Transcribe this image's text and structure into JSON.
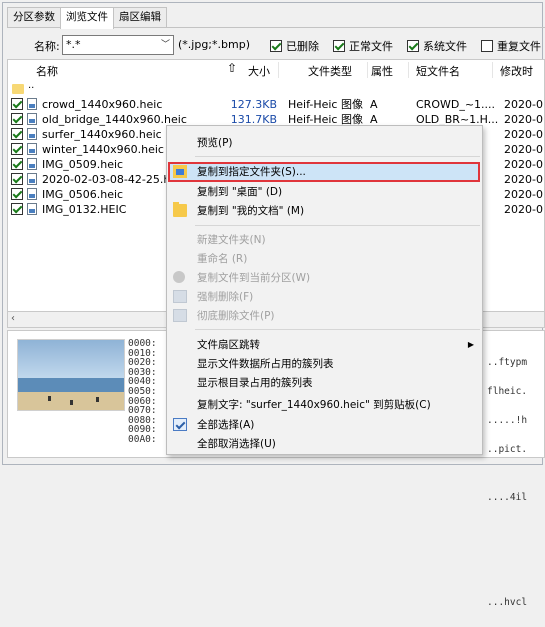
{
  "tabs": [
    "分区参数",
    "浏览文件",
    "扇区编辑"
  ],
  "filter": {
    "name_label": "名称:",
    "name_value": "*.*",
    "extensions": "(*.jpg;*.bmp)",
    "checkboxes": [
      {
        "label": "已删除",
        "checked": true
      },
      {
        "label": "正常文件",
        "checked": true
      },
      {
        "label": "系统文件",
        "checked": true
      },
      {
        "label": "重复文件",
        "checked": false
      }
    ]
  },
  "columns": {
    "name": "名称",
    "size": "大小",
    "type": "文件类型",
    "attr": "属性",
    "short": "短文件名",
    "modified": "修改时"
  },
  "up_row_label": "..",
  "files": [
    {
      "name": "crowd_1440x960.heic",
      "size": "127.3KB",
      "type": "Heif-Heic 图像",
      "attr": "A",
      "short": "CROWD_~1....",
      "modified": "2020-0"
    },
    {
      "name": "old_bridge_1440x960.heic",
      "size": "131.7KB",
      "type": "Heif-Heic 图像",
      "attr": "A",
      "short": "OLD_BR~1.H...",
      "modified": "2020-0"
    },
    {
      "name": "surfer_1440x960.heic",
      "size": "",
      "type": "",
      "attr": "",
      "short": "",
      "modified": "2020-0"
    },
    {
      "name": "winter_1440x960.heic",
      "size": "",
      "type": "",
      "attr": "",
      "short": "",
      "modified": "2020-0"
    },
    {
      "name": "IMG_0509.heic",
      "size": "",
      "type": "",
      "attr": "",
      "short": "",
      "modified": "2020-0"
    },
    {
      "name": "2020-02-03-08-42-25.h",
      "size": "",
      "type": "",
      "attr": "",
      "short": "",
      "modified": "2020-0"
    },
    {
      "name": "IMG_0506.heic",
      "size": "",
      "type": "",
      "attr": "",
      "short": "",
      "modified": "2020-0"
    },
    {
      "name": "IMG_0132.HEIC",
      "size": "",
      "type": "",
      "attr": "",
      "short": "",
      "modified": "2020-0"
    }
  ],
  "hex_offsets": [
    "0000:",
    "0010:",
    "0020:",
    "0030:",
    "0040:",
    "0050:",
    "0060:",
    "0070:",
    "0080:",
    "0090:",
    "00A0:"
  ],
  "hex_ascii": [
    "..ftypm",
    "flheic.",
    ".....!h",
    "..pict.",
    "",
    "....4il",
    "",
    "",
    "",
    "",
    "...hvcl"
  ],
  "context_menu": {
    "items": [
      {
        "label": "预览(P)",
        "disabled": false,
        "icon": ""
      },
      {
        "label": "复制到指定文件夹(S)...",
        "disabled": false,
        "icon": "folder-copy-icon"
      },
      {
        "label": "复制到 \"桌面\" (D)",
        "disabled": false,
        "icon": ""
      },
      {
        "label": "复制到 \"我的文档\" (M)",
        "disabled": false,
        "icon": "folder-icon"
      },
      {
        "label": "新建文件夹(N)",
        "disabled": true,
        "icon": ""
      },
      {
        "label": "重命名 (R)",
        "disabled": true,
        "icon": ""
      },
      {
        "label": "复制文件到当前分区(W)",
        "disabled": true,
        "icon": "copy-to-partition-icon"
      },
      {
        "label": "强制删除(F)",
        "disabled": true,
        "icon": "force-delete-icon"
      },
      {
        "label": "彻底删除文件(P)",
        "disabled": true,
        "icon": "permanent-delete-icon"
      },
      {
        "label": "文件扇区跳转",
        "disabled": false,
        "icon": "",
        "submenu": true
      },
      {
        "label": "显示文件数据所占用的簇列表",
        "disabled": false,
        "icon": ""
      },
      {
        "label": "显示根目录占用的簇列表",
        "disabled": false,
        "icon": ""
      },
      {
        "label": "复制文字: \"surfer_1440x960.heic\" 到剪贴板(C)",
        "disabled": false,
        "icon": ""
      },
      {
        "label": "全部选择(A)",
        "disabled": false,
        "icon": "select-all-icon"
      },
      {
        "label": "全部取消选择(U)",
        "disabled": false,
        "icon": ""
      }
    ]
  },
  "colors": {
    "highlight_border": "#e0353b",
    "highlight_fill": "#cde4f7",
    "size_text": "#1a4aa8"
  }
}
